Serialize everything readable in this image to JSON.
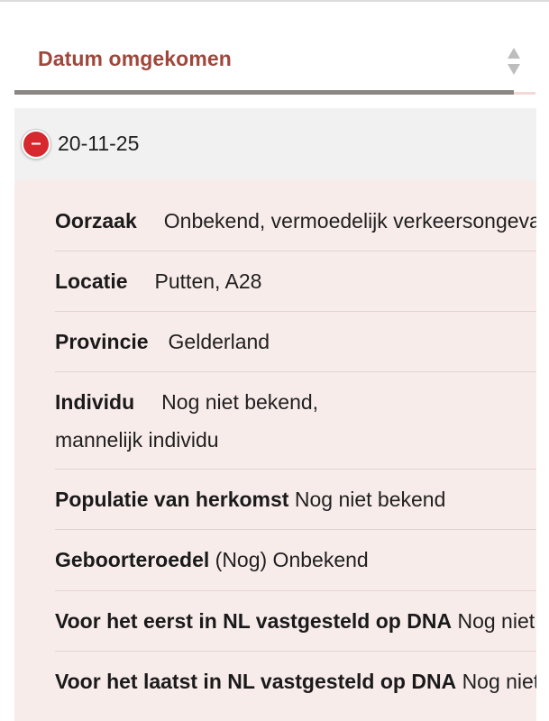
{
  "table": {
    "sort_header": {
      "label": "Datum omgekomen",
      "icon": "sort-arrows-icon"
    },
    "row": {
      "date": "20-11-25",
      "toggle_icon": "minus-icon",
      "toggle_symbol": "–",
      "details": [
        {
          "label": "Oorzaak",
          "value": "Onbekend, vermoedelijk verkeersongeval"
        },
        {
          "label": "Locatie",
          "value": "Putten, A28"
        },
        {
          "label": "Provincie",
          "value": "Gelderland"
        },
        {
          "label": "Individu",
          "value": "Nog niet bekend, mannelijk individu"
        },
        {
          "label": "Populatie van herkomst",
          "value": "Nog niet bekend"
        },
        {
          "label": "Geboorteroedel",
          "value": "(Nog) Onbekend"
        },
        {
          "label": "Voor het eerst in NL vastgesteld op DNA",
          "value": "Nog niet bekend"
        },
        {
          "label": "Voor het laatst in NL vastgesteld op DNA",
          "value": "Nog niet bekend"
        }
      ]
    }
  },
  "colors": {
    "accent": "#a0473c",
    "toggle": "#d7282f",
    "details_bg": "#f8eceb",
    "row_header_bg": "#f1f1f1"
  }
}
